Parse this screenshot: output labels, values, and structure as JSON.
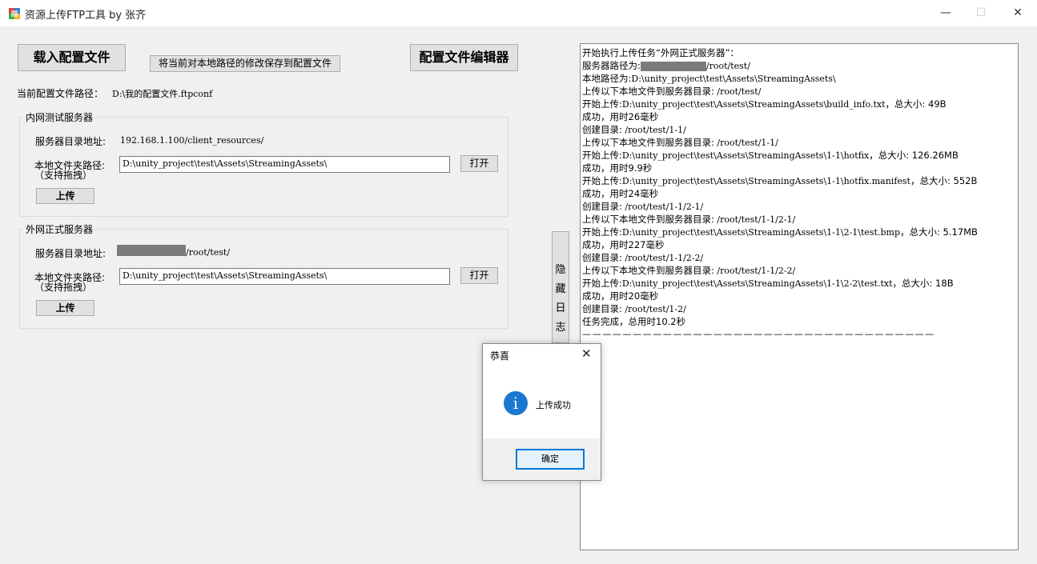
{
  "window": {
    "title": "资源上传FTP工具 by 张齐",
    "minimize_glyph": "—",
    "maximize_glyph": "☐",
    "close_glyph": "✕"
  },
  "toolbar": {
    "load_config_label": "载入配置文件",
    "save_path_label": "将当前对本地路径的修改保存到配置文件",
    "config_editor_label": "配置文件编辑器"
  },
  "config_path": {
    "label": "当前配置文件路径：",
    "value": "D:\\我的配置文件.ftpconf"
  },
  "intranet": {
    "group_title": "内网测试服务器",
    "server_dir_label": "服务器目录地址:",
    "server_dir_value": "192.168.1.100/client_resources/",
    "local_path_label_line1": "本地文件夹路径:",
    "local_path_label_line2": "（支持拖拽）",
    "local_path_value": "D:\\unity_project\\test\\Assets\\StreamingAssets\\",
    "open_label": "打开",
    "upload_label": "上传"
  },
  "external": {
    "group_title": "外网正式服务器",
    "server_dir_label": "服务器目录地址:",
    "server_dir_value": "/root/test/",
    "local_path_label_line1": "本地文件夹路径:",
    "local_path_label_line2": "（支持拖拽）",
    "local_path_value": "D:\\unity_project\\test\\Assets\\StreamingAssets\\",
    "open_label": "打开",
    "upload_label": "上传"
  },
  "hide_log_button": [
    "隐",
    "藏",
    "日",
    "志"
  ],
  "log": {
    "lines": [
      {
        "zh": "开始执行上传任务“外网正式服务器”：",
        "m": ""
      },
      {
        "zh": "服务器路径为:",
        "m": "/root/test/",
        "redacted": true
      },
      {
        "zh": "本地路径为:",
        "m": "D:\\unity_project\\test\\Assets\\StreamingAssets\\"
      },
      {
        "zh": "上传以下本地文件到服务器目录:",
        "m": " /root/test/"
      },
      {
        "zh": "开始上传:",
        "m": "D:\\unity_project\\test\\Assets\\StreamingAssets\\build_info.txt",
        "tail": "，总大小: 49B"
      },
      {
        "zh": "成功，用时26毫秒",
        "m": ""
      },
      {
        "zh": "创建目录:",
        "m": " /root/test/1-1/"
      },
      {
        "zh": "上传以下本地文件到服务器目录:",
        "m": " /root/test/1-1/"
      },
      {
        "zh": "开始上传:",
        "m": "D:\\unity_project\\test\\Assets\\StreamingAssets\\1-1\\hotfix",
        "tail": "，总大小: 126.26MB"
      },
      {
        "zh": "成功，用时9.9秒",
        "m": ""
      },
      {
        "zh": "开始上传:",
        "m": "D:\\unity_project\\test\\Assets\\StreamingAssets\\1-1\\hotfix.manifest",
        "tail": "，总大小: 552B"
      },
      {
        "zh": "成功，用时24毫秒",
        "m": ""
      },
      {
        "zh": "创建目录:",
        "m": " /root/test/1-1/2-1/"
      },
      {
        "zh": "上传以下本地文件到服务器目录:",
        "m": " /root/test/1-1/2-1/"
      },
      {
        "zh": "开始上传:",
        "m": "D:\\unity_project\\test\\Assets\\StreamingAssets\\1-1\\2-1\\test.bmp",
        "tail": "，总大小: 5.17MB"
      },
      {
        "zh": "成功，用时227毫秒",
        "m": ""
      },
      {
        "zh": "创建目录:",
        "m": " /root/test/1-1/2-2/"
      },
      {
        "zh": "上传以下本地文件到服务器目录:",
        "m": " /root/test/1-1/2-2/"
      },
      {
        "zh": "开始上传:",
        "m": "D:\\unity_project\\test\\Assets\\StreamingAssets\\1-1\\2-2\\test.txt",
        "tail": "，总大小: 18B"
      },
      {
        "zh": "成功，用时20毫秒",
        "m": ""
      },
      {
        "zh": "创建目录:",
        "m": " /root/test/1-2/"
      },
      {
        "zh": "任务完成，总用时10.2秒",
        "m": ""
      }
    ],
    "separator": "———————————————————————————————————"
  },
  "dialog": {
    "title": "恭喜",
    "close_glyph": "✕",
    "icon_glyph": "i",
    "message": "上传成功",
    "ok_label": "确定"
  },
  "colors": {
    "background": "#f0f0f0",
    "info_icon": "#1a77d2",
    "focus_border": "#0078d7",
    "redaction": "#7b7b7b"
  }
}
